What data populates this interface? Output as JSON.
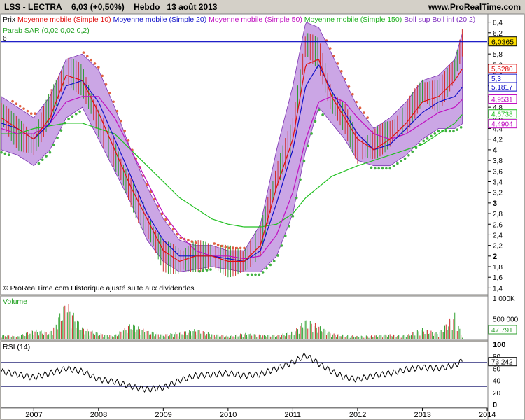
{
  "header": {
    "ticker": "LSS - LECTRA",
    "quote": "6,03 (+0,50%)",
    "period": "Hebdo",
    "date": "13 août 2013",
    "site": "www.ProRealTime.com"
  },
  "legend": {
    "prix": "Prix",
    "ma10": "Moyenne mobile (Simple 10)",
    "ma20": "Moyenne mobile (Simple 20)",
    "ma50": "Moyenne mobile (Simple 50)",
    "ma150": "Moyenne mobile (Simple 150)",
    "boll": "Boll sup Boll inf (20 2)",
    "sar": "Parab SAR (0,02 0,02 0,2)",
    "level_mark": "6"
  },
  "footnote": "© ProRealTime.com  Historique ajusté suite aux dividendes",
  "colors": {
    "price": "#1a8c1a",
    "ma10": "#e01010",
    "ma20": "#1010c8",
    "ma50": "#c010c0",
    "ma150": "#20c020",
    "boll_fill": "#a05cd0",
    "sar_up": "#40b040",
    "sar_down": "#e06040",
    "level": "#0000c0"
  },
  "chart_data": [
    {
      "type": "line",
      "panel": "price",
      "ylim": [
        1.3,
        6.5
      ],
      "yticks": [
        "1,4",
        "1,6",
        "1,8",
        "2",
        "2,2",
        "2,4",
        "2,6",
        "2,8",
        "3",
        "3,2",
        "3,4",
        "3,6",
        "3,8",
        "4",
        "4,2",
        "4,4",
        "4,6",
        "4,8",
        "5",
        "5,2",
        "5,4",
        "5,6",
        "5,8",
        "6",
        "6,2",
        "6,4"
      ],
      "price_label": "6,0365",
      "level_line": 6.03,
      "value_labels": [
        {
          "series": "ma10",
          "value": 5.528,
          "text": "5,5280"
        },
        {
          "series": "ma20",
          "value": 5.34,
          "text": "5,3"
        },
        {
          "series": "boll_mid",
          "value": 5.1817,
          "text": "5,1817"
        },
        {
          "series": "boll",
          "value": 4.9531,
          "text": "4,9531"
        },
        {
          "series": "ma150",
          "value": 4.6738,
          "text": "4,6738"
        },
        {
          "series": "ma50",
          "value": 4.4904,
          "text": "4,4904"
        }
      ],
      "x": [
        2006.5,
        2006.75,
        2007.0,
        2007.25,
        2007.5,
        2007.75,
        2008.0,
        2008.25,
        2008.5,
        2008.75,
        2009.0,
        2009.25,
        2009.5,
        2009.75,
        2010.0,
        2010.25,
        2010.5,
        2010.75,
        2011.0,
        2011.2,
        2011.4,
        2011.6,
        2011.8,
        2012.0,
        2012.25,
        2012.5,
        2012.75,
        2013.0,
        2013.25,
        2013.5,
        2013.62
      ],
      "series": [
        {
          "name": "Prix",
          "values": [
            4.7,
            4.3,
            4.1,
            4.8,
            5.5,
            5.3,
            4.5,
            3.9,
            3.2,
            2.6,
            2.0,
            1.9,
            2.0,
            2.0,
            1.9,
            1.9,
            2.3,
            3.5,
            4.3,
            6.0,
            5.8,
            4.9,
            4.6,
            4.0,
            4.1,
            4.3,
            4.6,
            5.1,
            5.0,
            5.5,
            6.03
          ]
        },
        {
          "name": "Moyenne mobile (Simple 10)",
          "values": [
            4.6,
            4.4,
            4.2,
            4.6,
            5.4,
            5.3,
            4.7,
            4.0,
            3.3,
            2.7,
            2.1,
            1.9,
            2.0,
            2.0,
            1.9,
            1.9,
            2.2,
            3.3,
            4.2,
            5.6,
            5.7,
            5.0,
            4.6,
            4.2,
            4.0,
            4.2,
            4.5,
            4.9,
            5.0,
            5.3,
            5.53
          ]
        },
        {
          "name": "Moyenne mobile (Simple 20)",
          "values": [
            4.5,
            4.4,
            4.2,
            4.5,
            5.2,
            5.3,
            4.9,
            4.2,
            3.5,
            2.8,
            2.3,
            2.0,
            2.0,
            2.0,
            1.95,
            1.9,
            2.1,
            3.0,
            4.0,
            5.2,
            5.6,
            5.1,
            4.7,
            4.3,
            4.0,
            4.1,
            4.4,
            4.7,
            4.9,
            5.0,
            5.18
          ]
        },
        {
          "name": "Moyenne mobile (Simple 50)",
          "values": [
            4.4,
            4.3,
            4.3,
            4.5,
            4.9,
            5.0,
            5.0,
            4.6,
            4.0,
            3.4,
            2.8,
            2.4,
            2.1,
            2.0,
            2.0,
            1.95,
            2.0,
            2.4,
            3.2,
            4.2,
            4.9,
            5.0,
            4.9,
            4.6,
            4.3,
            4.2,
            4.3,
            4.5,
            4.7,
            4.8,
            4.95
          ]
        },
        {
          "name": "Moyenne mobile (Simple 150)",
          "values": [
            4.3,
            4.3,
            4.4,
            4.45,
            4.5,
            4.5,
            4.4,
            4.3,
            4.0,
            3.7,
            3.4,
            3.1,
            2.9,
            2.7,
            2.6,
            2.55,
            2.55,
            2.6,
            2.8,
            3.1,
            3.3,
            3.5,
            3.6,
            3.7,
            3.8,
            3.9,
            4.0,
            4.1,
            4.3,
            4.5,
            4.67
          ]
        },
        {
          "name": "Boll sup",
          "values": [
            5.0,
            4.8,
            4.6,
            5.0,
            5.7,
            5.8,
            5.5,
            4.8,
            4.0,
            3.3,
            2.7,
            2.3,
            2.2,
            2.2,
            2.1,
            2.1,
            2.6,
            4.0,
            5.2,
            6.4,
            6.3,
            5.8,
            5.3,
            4.8,
            4.4,
            4.6,
            4.9,
            5.3,
            5.4,
            5.7,
            6.2
          ]
        },
        {
          "name": "Boll inf",
          "values": [
            4.0,
            3.9,
            3.7,
            4.0,
            4.6,
            4.8,
            4.2,
            3.6,
            3.0,
            2.3,
            1.9,
            1.7,
            1.75,
            1.8,
            1.75,
            1.7,
            1.7,
            2.0,
            2.8,
            4.0,
            4.8,
            4.5,
            4.2,
            3.8,
            3.7,
            3.7,
            3.9,
            4.2,
            4.4,
            4.4,
            4.49
          ]
        }
      ]
    },
    {
      "type": "bar",
      "panel": "volume",
      "name": "Volume",
      "yticks": [
        "1 000K",
        "500 000"
      ],
      "last_label": "47 791",
      "ylim": [
        0,
        1000000
      ],
      "values": [
        120000,
        80000,
        250000,
        180000,
        950000,
        300000,
        160000,
        110000,
        400000,
        220000,
        130000,
        180000,
        260000,
        150000,
        90000,
        160000,
        120000,
        110000,
        200000,
        500000,
        350000,
        150000,
        120000,
        90000,
        100000,
        130000,
        110000,
        280000,
        160000,
        650000,
        47791
      ]
    },
    {
      "type": "line",
      "panel": "rsi",
      "name": "RSI (14)",
      "ylim": [
        0,
        100
      ],
      "yticks": [
        "0",
        "20",
        "40",
        "60",
        "80",
        "100"
      ],
      "bands": [
        30,
        70
      ],
      "last_label": "73,242",
      "values": [
        55,
        50,
        45,
        52,
        60,
        55,
        42,
        38,
        30,
        25,
        28,
        40,
        48,
        50,
        52,
        48,
        50,
        60,
        70,
        82,
        68,
        55,
        45,
        42,
        48,
        52,
        58,
        62,
        60,
        65,
        73.242
      ]
    }
  ],
  "xaxis": {
    "years": [
      "2007",
      "2008",
      "2009",
      "2010",
      "2011",
      "2012",
      "2013",
      "2014"
    ],
    "xlim": [
      2006.5,
      2014.0
    ]
  }
}
